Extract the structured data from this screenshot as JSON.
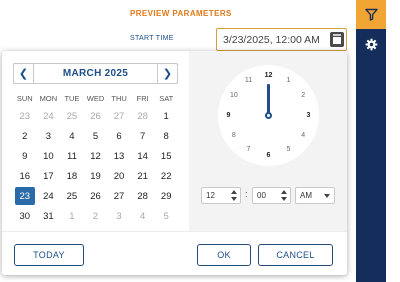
{
  "params": {
    "title": "PREVIEW PARAMETERS",
    "start_time_label": "START TIME",
    "start_time_value": "3/23/2025, 12:00 AM"
  },
  "rail": {
    "filter_icon": "filter-icon",
    "gear_icon": "gear-icon",
    "accent_color": "#f0a534",
    "rail_color": "#142d5b"
  },
  "calendar": {
    "month_label": "MARCH 2025",
    "prev_icon": "chevron-left-icon",
    "next_icon": "chevron-right-icon",
    "weekdays": [
      "SUN",
      "MON",
      "TUE",
      "WED",
      "THU",
      "FRI",
      "SAT"
    ],
    "weeks": [
      [
        "23",
        "24",
        "25",
        "26",
        "27",
        "28",
        "1"
      ],
      [
        "2",
        "3",
        "4",
        "5",
        "6",
        "7",
        "8"
      ],
      [
        "9",
        "10",
        "11",
        "12",
        "13",
        "14",
        "15"
      ],
      [
        "16",
        "17",
        "18",
        "19",
        "20",
        "21",
        "22"
      ],
      [
        "23",
        "24",
        "25",
        "26",
        "27",
        "28",
        "29"
      ],
      [
        "30",
        "31",
        "1",
        "2",
        "3",
        "4",
        "5"
      ]
    ],
    "selected_day": "23",
    "selected_color": "#2b6aa9"
  },
  "clock": {
    "numbers": [
      "12",
      "1",
      "2",
      "3",
      "4",
      "5",
      "6",
      "7",
      "8",
      "9",
      "10",
      "11"
    ],
    "hour": "12",
    "minute": "00",
    "period": "AM"
  },
  "footer": {
    "today_label": "TODAY",
    "ok_label": "OK",
    "cancel_label": "CANCEL"
  }
}
